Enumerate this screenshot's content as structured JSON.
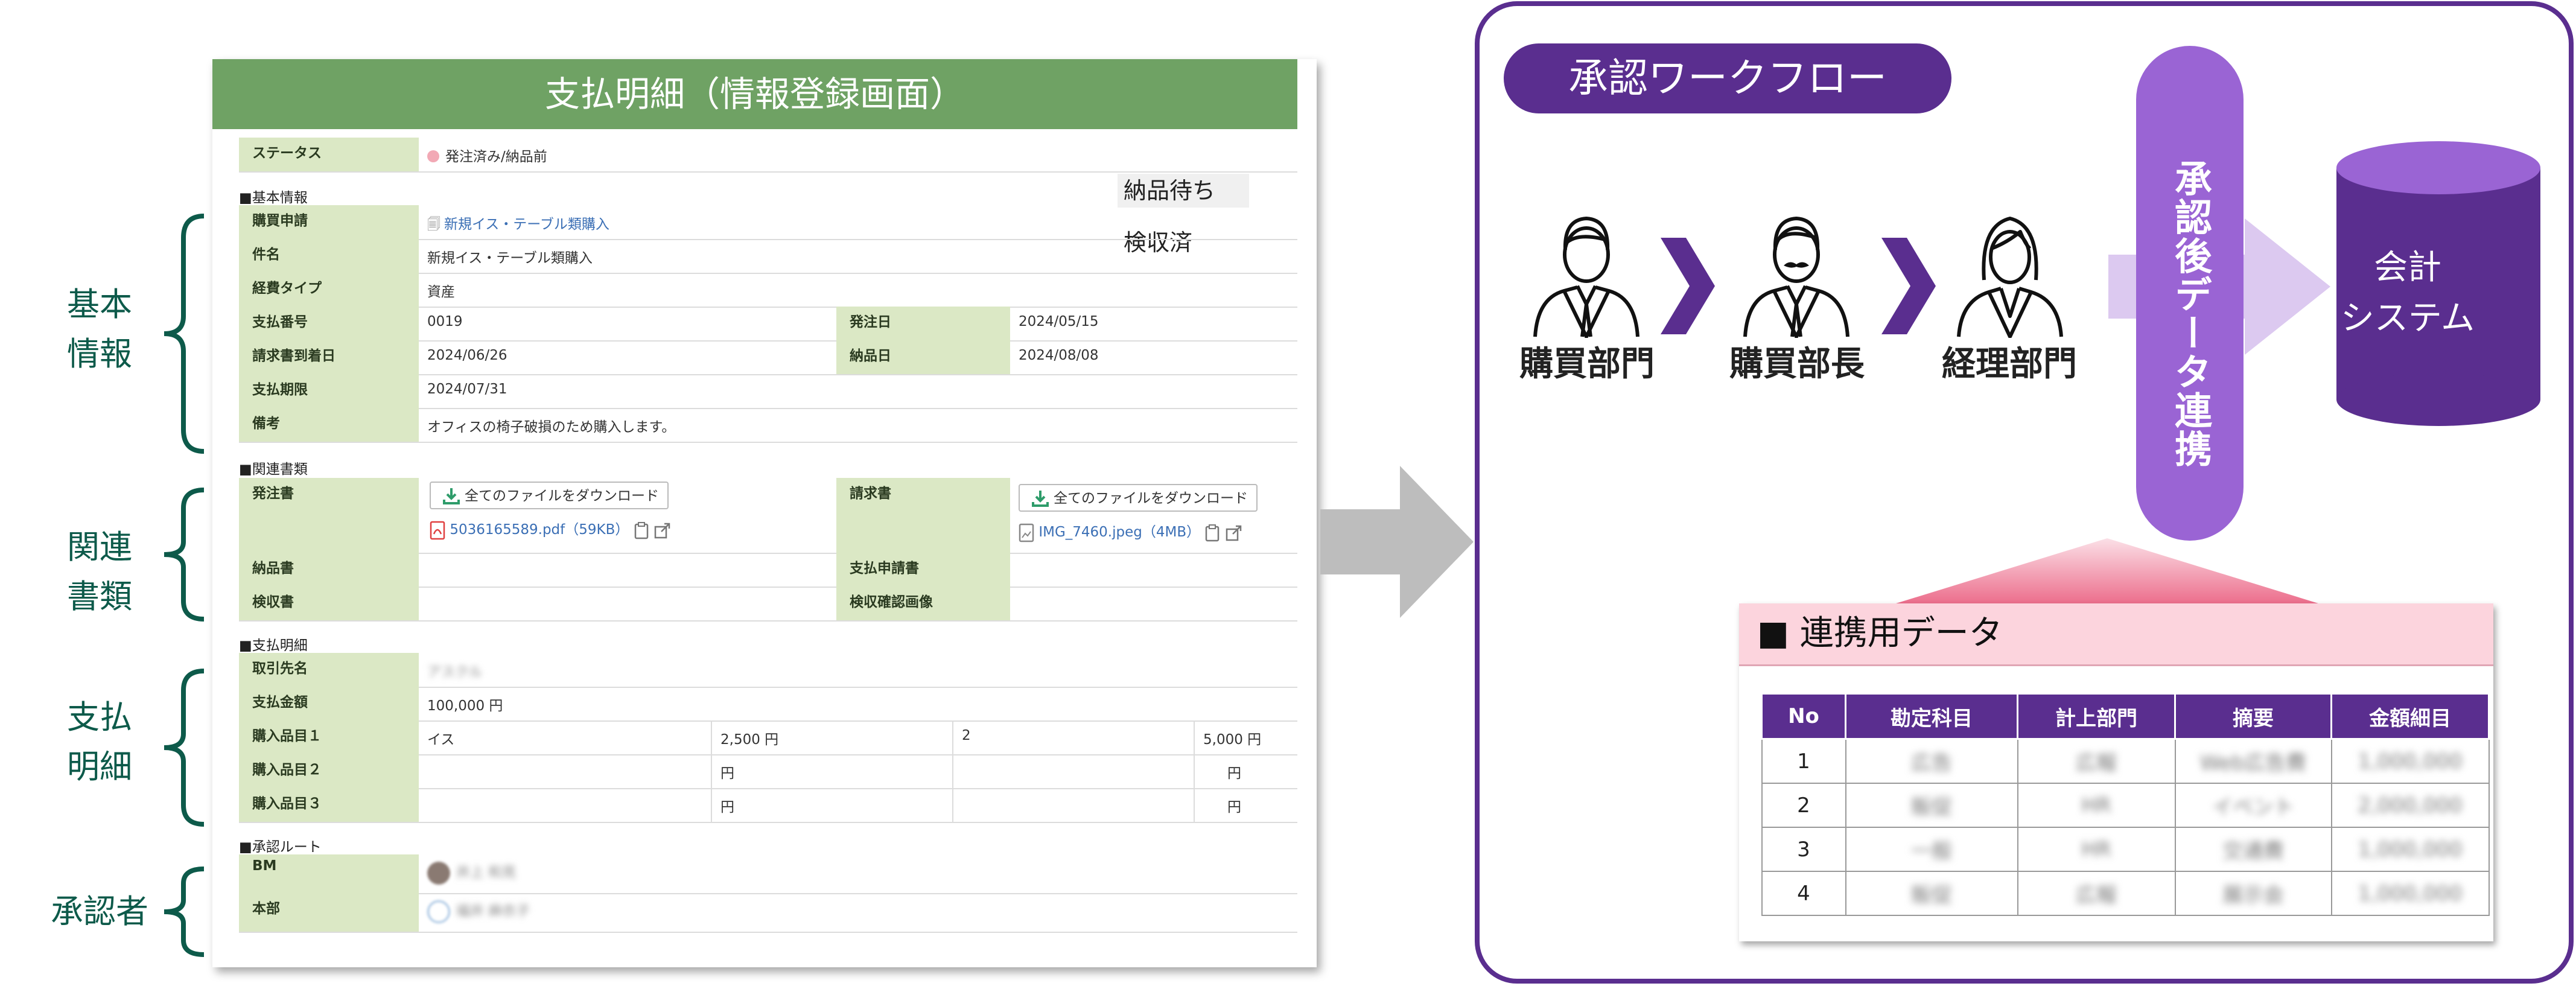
{
  "annotations": {
    "basic": "基本\n情報",
    "related": "関連\n書類",
    "payment": "支払\n明細",
    "approver": "承認者"
  },
  "form": {
    "title": "支払明細（情報登録画面）",
    "status_label": "ステータス",
    "status_value": "発注済み/納品前",
    "status_options": [
      "納品待ち",
      "検収済"
    ],
    "sections": {
      "basic": "■基本情報",
      "related": "■関連書類",
      "payment": "■支払明細",
      "route": "■承認ルート"
    },
    "basic": {
      "purchase_request_label": "購買申請",
      "purchase_request_value": "新規イス・テーブル類購入",
      "subject_label": "件名",
      "subject_value": "新規イス・テーブル類購入",
      "expense_type_label": "経費タイプ",
      "expense_type_value": "資産",
      "payment_no_label": "支払番号",
      "payment_no_value": "0019",
      "order_date_label": "発注日",
      "order_date_value": "2024/05/15",
      "invoice_arrival_label": "請求書到着日",
      "invoice_arrival_value": "2024/06/26",
      "delivery_date_label": "納品日",
      "delivery_date_value": "2024/08/08",
      "due_label": "支払期限",
      "due_value": "2024/07/31",
      "note_label": "備考",
      "note_value": "オフィスの椅子破損のため購入します。"
    },
    "related": {
      "order_doc_label": "発注書",
      "invoice_label": "請求書",
      "download_all": "全てのファイルをダウンロード",
      "order_file": "5036165589.pdf（59KB）",
      "invoice_file": "IMG_7460.jpeg（4MB）",
      "delivery_note_label": "納品書",
      "payment_request_label": "支払申請書",
      "inspection_label": "検収書",
      "inspection_image_label": "検収確認画像"
    },
    "payment": {
      "vendor_label": "取引先名",
      "vendor_value": "アスクル",
      "amount_label": "支払金額",
      "amount_value": "100,000 円",
      "items": [
        {
          "label": "購入品目１",
          "name": "イス",
          "price": "2,500 円",
          "qty": "2",
          "total": "5,000 円"
        },
        {
          "label": "購入品目２",
          "name": "",
          "price": "円",
          "qty": "",
          "total": "円"
        },
        {
          "label": "購入品目３",
          "name": "",
          "price": "円",
          "qty": "",
          "total": "円"
        }
      ]
    },
    "route": {
      "bm_label": "BM",
      "bm_value": "井上 和見",
      "hq_label": "本部",
      "hq_value": "福井 麻衣子"
    }
  },
  "workflow": {
    "title": "承認ワークフロー",
    "steps": [
      "購買部門",
      "購買部長",
      "経理部門"
    ],
    "pill_text": "承認後データ連携",
    "system_label": "会計\nシステム",
    "link_data_title": "■ 連携用データ",
    "table": {
      "headers": [
        "No",
        "勘定科目",
        "計上部門",
        "摘要",
        "金額細目"
      ],
      "rows": [
        [
          "1",
          "広告",
          "広報",
          "Web広告費",
          "1,000,000"
        ],
        [
          "2",
          "販促",
          "HR",
          "イベント",
          "2,000,000"
        ],
        [
          "3",
          "一般",
          "HR",
          "交通費",
          "1,000,000"
        ],
        [
          "4",
          "販促",
          "広報",
          "展示会",
          "1,000,000"
        ]
      ]
    }
  },
  "colors": {
    "form_header": "#6fa264",
    "label_bg": "#dbe8c5",
    "purple": "#5a2e8f",
    "pill": "#9a64d4",
    "annot_green": "#0d5a4a",
    "pink": "#fcd4dd"
  }
}
